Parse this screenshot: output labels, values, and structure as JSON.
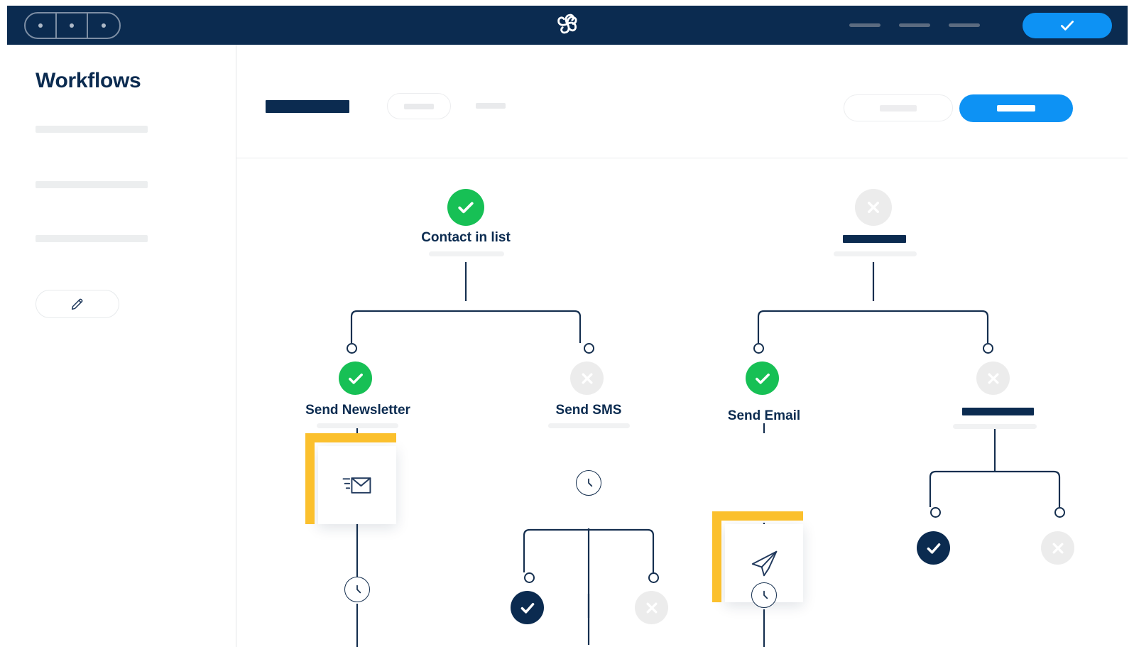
{
  "topnav": {
    "background": "#0b2b50",
    "segments": [
      {
        "name": "segment-1",
        "icon": "dot-icon"
      },
      {
        "name": "segment-2",
        "icon": "dot-icon"
      },
      {
        "name": "segment-3",
        "icon": "dot-icon"
      }
    ],
    "logo_icon": "brevo-pinwheel-logo",
    "menu_placeholders": [
      "",
      "",
      ""
    ],
    "cta": {
      "icon": "check-icon",
      "color": "#0d92f4"
    }
  },
  "sidebar": {
    "title": "Workflows",
    "items": [
      {
        "label": "",
        "name": "sidebar-item-1"
      },
      {
        "label": "",
        "name": "sidebar-item-2"
      },
      {
        "label": "",
        "name": "sidebar-item-3"
      }
    ],
    "edit_button": {
      "icon": "pencil-icon",
      "label": ""
    }
  },
  "toolbar": {
    "title_placeholder": "",
    "pill_label": "",
    "tab_label": "",
    "secondary_label": "",
    "primary_label": "",
    "primary_color": "#0d92f4"
  },
  "colors": {
    "navy": "#0b2b50",
    "blue": "#0d92f4",
    "green": "#17c055",
    "grey": "#ececec",
    "yellow": "#fbc02d",
    "wire": "#152f4f"
  },
  "workflow": {
    "roots": [
      {
        "name": "contact-in-list",
        "status": "success",
        "status_icon": "check-circle-icon",
        "label": "Contact in list",
        "has_label": true,
        "has_placeholder": false,
        "has_rule": true
      },
      {
        "name": "masked-trigger",
        "status": "inactive",
        "status_icon": "x-circle-icon",
        "label": "",
        "has_label": false,
        "has_placeholder": true,
        "has_rule": true
      }
    ],
    "branches": [
      {
        "name": "send-newsletter",
        "status": "success",
        "status_icon": "check-circle-icon",
        "label": "Send Newsletter",
        "has_label": true,
        "has_placeholder": false,
        "has_rule": true,
        "card_icon": "email-send-icon",
        "delay_icon": "clock-icon"
      },
      {
        "name": "send-sms",
        "status": "inactive",
        "status_icon": "x-circle-icon",
        "label": "Send SMS",
        "has_label": true,
        "has_placeholder": false,
        "has_rule": true,
        "card_icon": "",
        "delay_icon": "clock-icon"
      },
      {
        "name": "send-email",
        "status": "success",
        "status_icon": "check-circle-icon",
        "label": "Send Email",
        "has_label": true,
        "has_placeholder": false,
        "has_rule": false,
        "card_icon": "paper-plane-icon",
        "delay_icon": "clock-icon"
      },
      {
        "name": "masked-action",
        "status": "inactive",
        "status_icon": "x-circle-icon",
        "label": "",
        "has_label": false,
        "has_placeholder": true,
        "has_rule": true,
        "card_icon": "",
        "delay_icon": ""
      }
    ],
    "leaves": [
      {
        "name": "sms-leaf-yes",
        "status": "selected",
        "status_icon": "check-circle-icon"
      },
      {
        "name": "sms-leaf-no",
        "status": "inactive",
        "status_icon": "x-circle-icon"
      },
      {
        "name": "masked-leaf-yes",
        "status": "selected",
        "status_icon": "check-circle-icon"
      },
      {
        "name": "masked-leaf-no",
        "status": "inactive",
        "status_icon": "x-circle-icon"
      }
    ]
  }
}
